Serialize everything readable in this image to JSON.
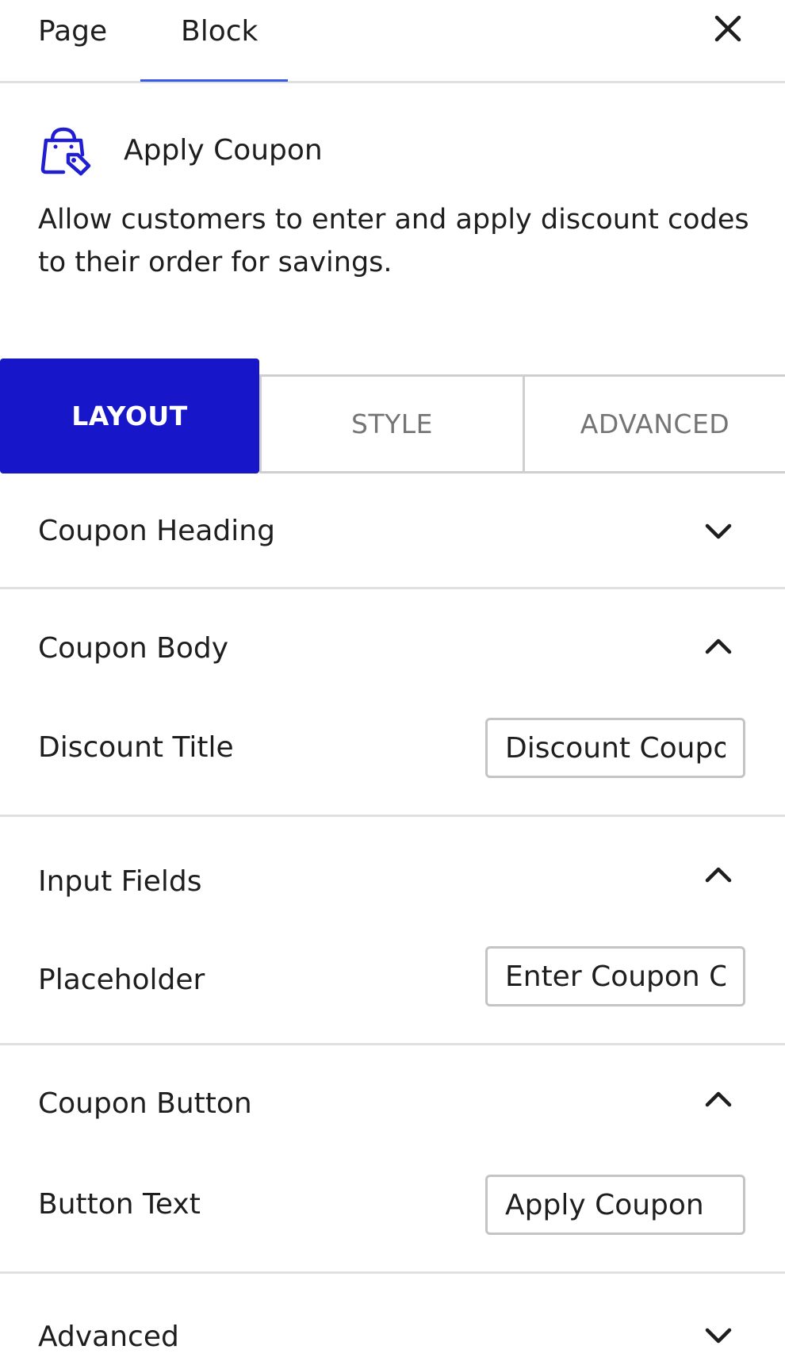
{
  "top_tabs": {
    "page_label": "Page",
    "block_label": "Block",
    "active": "Block"
  },
  "block": {
    "icon": "shopping-bag-tag-icon",
    "name": "Apply Coupon",
    "description": "Allow customers to enter and apply discount codes to their order for savings."
  },
  "settings_tabs": {
    "layout": "LAYOUT",
    "style": "STYLE",
    "advanced": "ADVANCED",
    "active": "LAYOUT"
  },
  "sections": {
    "coupon_heading": {
      "title": "Coupon Heading",
      "expanded": false
    },
    "coupon_body": {
      "title": "Coupon Body",
      "expanded": true,
      "field_label": "Discount Title",
      "field_value": "Discount Coupon"
    },
    "input_fields": {
      "title": "Input Fields",
      "expanded": true,
      "field_label": "Placeholder",
      "field_value": "Enter Coupon Code"
    },
    "coupon_button": {
      "title": "Coupon Button",
      "expanded": true,
      "field_label": "Button Text",
      "field_value": "Apply Coupon"
    },
    "advanced": {
      "title": "Advanced",
      "expanded": false
    }
  },
  "colors": {
    "accent": "#1717c9",
    "tab_underline": "#3858e9",
    "icon": "#1f1fd1",
    "divider": "#e0e0e0"
  }
}
